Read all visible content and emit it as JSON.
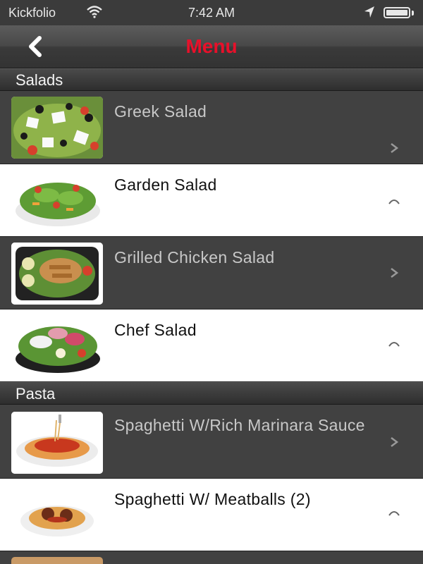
{
  "status_bar": {
    "carrier": "Kickfolio",
    "time": "7:42 AM",
    "battery_level": 1.0,
    "icons": [
      "wifi-icon",
      "location-arrow-icon",
      "battery-icon"
    ]
  },
  "navbar": {
    "title": "Menu",
    "back_icon": "chevron-left-icon",
    "title_color": "#e8102a"
  },
  "sections": [
    {
      "title": "Salads",
      "items": [
        {
          "name": "Greek Salad",
          "style": "dark",
          "thumb": "greek-salad-photo"
        },
        {
          "name": "Garden Salad",
          "style": "light",
          "thumb": "garden-salad-photo"
        },
        {
          "name": "Grilled Chicken Salad",
          "style": "dark",
          "thumb": "grilled-chicken-salad-photo"
        },
        {
          "name": "Chef Salad",
          "style": "light",
          "thumb": "chef-salad-photo"
        }
      ]
    },
    {
      "title": "Pasta",
      "items": [
        {
          "name": "Spaghetti W/Rich Marinara Sauce",
          "style": "dark",
          "thumb": "spaghetti-marinara-photo"
        },
        {
          "name": "Spaghetti W/ Meatballs (2)",
          "style": "light",
          "thumb": "spaghetti-meatballs-photo"
        }
      ]
    }
  ]
}
